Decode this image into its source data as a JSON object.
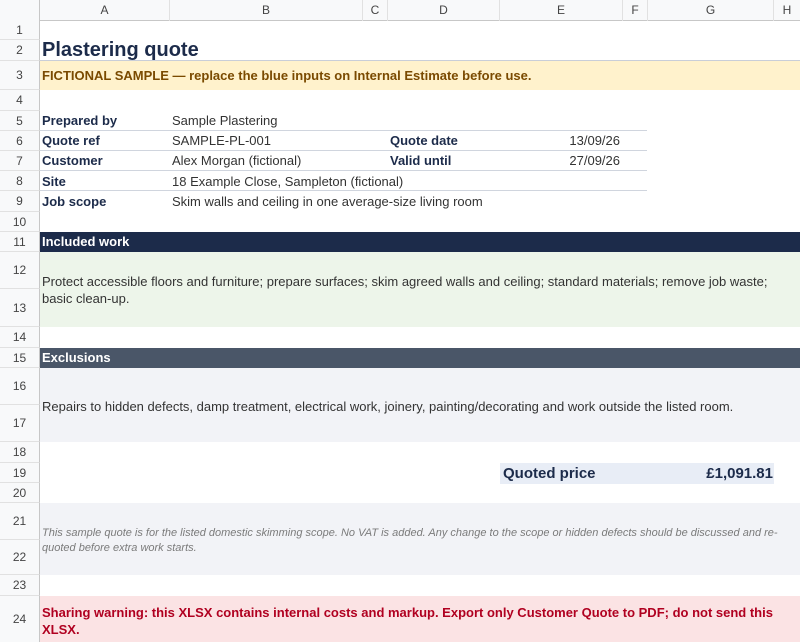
{
  "columns": [
    "A",
    "B",
    "C",
    "D",
    "E",
    "F",
    "G",
    "H"
  ],
  "rows": [
    "1",
    "2",
    "3",
    "4",
    "5",
    "6",
    "7",
    "8",
    "9",
    "10",
    "11",
    "12",
    "13",
    "14",
    "15",
    "16",
    "17",
    "18",
    "19",
    "20",
    "21",
    "22",
    "23",
    "24"
  ],
  "quote": {
    "title": "Plastering quote",
    "banner": "FICTIONAL SAMPLE — replace the blue inputs on Internal Estimate before use.",
    "prepared_by_label": "Prepared by",
    "prepared_by": "Sample Plastering",
    "quote_ref_label": "Quote ref",
    "quote_ref": "SAMPLE-PL-001",
    "quote_date_label": "Quote date",
    "quote_date": "13/09/26",
    "customer_label": "Customer",
    "customer": "Alex Morgan (fictional)",
    "valid_until_label": "Valid until",
    "valid_until": "27/09/26",
    "site_label": "Site",
    "site": "18 Example Close, Sampleton (fictional)",
    "job_scope_label": "Job scope",
    "job_scope": "Skim walls and ceiling in one average-size living room",
    "included_head": "Included work",
    "included_text": "Protect accessible floors and furniture; prepare surfaces; skim agreed walls and ceiling; standard materials; remove job waste; basic clean-up.",
    "exclusions_head": "Exclusions",
    "exclusions_text": "Repairs to hidden defects, damp treatment, electrical work, joinery, painting/decorating and work outside the listed room.",
    "price_label": "Quoted price",
    "price_value": "£1,091.81",
    "note": "This sample quote is for the listed domestic skimming scope. No VAT is added. Any change to the scope or hidden defects should be discussed and re-quoted before extra work starts.",
    "warning": "Sharing warning: this XLSX contains internal costs and markup. Export only Customer Quote to PDF; do not send this XLSX."
  },
  "colors": {
    "banner_bg": "#fff2cc",
    "included_head_bg": "#1c2b4a",
    "included_bg": "#edf5ea",
    "exclusions_head_bg": "#4a5668",
    "exclusions_bg": "#f2f3f7",
    "note_bg": "#f2f3f7",
    "warning_bg": "#fbe3e4"
  }
}
